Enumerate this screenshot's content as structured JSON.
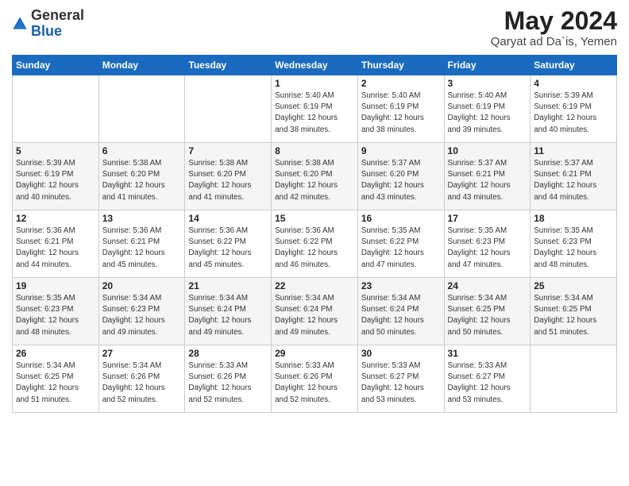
{
  "logo": {
    "general": "General",
    "blue": "Blue"
  },
  "title": "May 2024",
  "location": "Qaryat ad Da`is, Yemen",
  "weekdays": [
    "Sunday",
    "Monday",
    "Tuesday",
    "Wednesday",
    "Thursday",
    "Friday",
    "Saturday"
  ],
  "weeks": [
    [
      {
        "day": "",
        "info": ""
      },
      {
        "day": "",
        "info": ""
      },
      {
        "day": "",
        "info": ""
      },
      {
        "day": "1",
        "info": "Sunrise: 5:40 AM\nSunset: 6:19 PM\nDaylight: 12 hours\nand 38 minutes."
      },
      {
        "day": "2",
        "info": "Sunrise: 5:40 AM\nSunset: 6:19 PM\nDaylight: 12 hours\nand 38 minutes."
      },
      {
        "day": "3",
        "info": "Sunrise: 5:40 AM\nSunset: 6:19 PM\nDaylight: 12 hours\nand 39 minutes."
      },
      {
        "day": "4",
        "info": "Sunrise: 5:39 AM\nSunset: 6:19 PM\nDaylight: 12 hours\nand 40 minutes."
      }
    ],
    [
      {
        "day": "5",
        "info": "Sunrise: 5:39 AM\nSunset: 6:19 PM\nDaylight: 12 hours\nand 40 minutes."
      },
      {
        "day": "6",
        "info": "Sunrise: 5:38 AM\nSunset: 6:20 PM\nDaylight: 12 hours\nand 41 minutes."
      },
      {
        "day": "7",
        "info": "Sunrise: 5:38 AM\nSunset: 6:20 PM\nDaylight: 12 hours\nand 41 minutes."
      },
      {
        "day": "8",
        "info": "Sunrise: 5:38 AM\nSunset: 6:20 PM\nDaylight: 12 hours\nand 42 minutes."
      },
      {
        "day": "9",
        "info": "Sunrise: 5:37 AM\nSunset: 6:20 PM\nDaylight: 12 hours\nand 43 minutes."
      },
      {
        "day": "10",
        "info": "Sunrise: 5:37 AM\nSunset: 6:21 PM\nDaylight: 12 hours\nand 43 minutes."
      },
      {
        "day": "11",
        "info": "Sunrise: 5:37 AM\nSunset: 6:21 PM\nDaylight: 12 hours\nand 44 minutes."
      }
    ],
    [
      {
        "day": "12",
        "info": "Sunrise: 5:36 AM\nSunset: 6:21 PM\nDaylight: 12 hours\nand 44 minutes."
      },
      {
        "day": "13",
        "info": "Sunrise: 5:36 AM\nSunset: 6:21 PM\nDaylight: 12 hours\nand 45 minutes."
      },
      {
        "day": "14",
        "info": "Sunrise: 5:36 AM\nSunset: 6:22 PM\nDaylight: 12 hours\nand 45 minutes."
      },
      {
        "day": "15",
        "info": "Sunrise: 5:36 AM\nSunset: 6:22 PM\nDaylight: 12 hours\nand 46 minutes."
      },
      {
        "day": "16",
        "info": "Sunrise: 5:35 AM\nSunset: 6:22 PM\nDaylight: 12 hours\nand 47 minutes."
      },
      {
        "day": "17",
        "info": "Sunrise: 5:35 AM\nSunset: 6:23 PM\nDaylight: 12 hours\nand 47 minutes."
      },
      {
        "day": "18",
        "info": "Sunrise: 5:35 AM\nSunset: 6:23 PM\nDaylight: 12 hours\nand 48 minutes."
      }
    ],
    [
      {
        "day": "19",
        "info": "Sunrise: 5:35 AM\nSunset: 6:23 PM\nDaylight: 12 hours\nand 48 minutes."
      },
      {
        "day": "20",
        "info": "Sunrise: 5:34 AM\nSunset: 6:23 PM\nDaylight: 12 hours\nand 49 minutes."
      },
      {
        "day": "21",
        "info": "Sunrise: 5:34 AM\nSunset: 6:24 PM\nDaylight: 12 hours\nand 49 minutes."
      },
      {
        "day": "22",
        "info": "Sunrise: 5:34 AM\nSunset: 6:24 PM\nDaylight: 12 hours\nand 49 minutes."
      },
      {
        "day": "23",
        "info": "Sunrise: 5:34 AM\nSunset: 6:24 PM\nDaylight: 12 hours\nand 50 minutes."
      },
      {
        "day": "24",
        "info": "Sunrise: 5:34 AM\nSunset: 6:25 PM\nDaylight: 12 hours\nand 50 minutes."
      },
      {
        "day": "25",
        "info": "Sunrise: 5:34 AM\nSunset: 6:25 PM\nDaylight: 12 hours\nand 51 minutes."
      }
    ],
    [
      {
        "day": "26",
        "info": "Sunrise: 5:34 AM\nSunset: 6:25 PM\nDaylight: 12 hours\nand 51 minutes."
      },
      {
        "day": "27",
        "info": "Sunrise: 5:34 AM\nSunset: 6:26 PM\nDaylight: 12 hours\nand 52 minutes."
      },
      {
        "day": "28",
        "info": "Sunrise: 5:33 AM\nSunset: 6:26 PM\nDaylight: 12 hours\nand 52 minutes."
      },
      {
        "day": "29",
        "info": "Sunrise: 5:33 AM\nSunset: 6:26 PM\nDaylight: 12 hours\nand 52 minutes."
      },
      {
        "day": "30",
        "info": "Sunrise: 5:33 AM\nSunset: 6:27 PM\nDaylight: 12 hours\nand 53 minutes."
      },
      {
        "day": "31",
        "info": "Sunrise: 5:33 AM\nSunset: 6:27 PM\nDaylight: 12 hours\nand 53 minutes."
      },
      {
        "day": "",
        "info": ""
      }
    ]
  ]
}
